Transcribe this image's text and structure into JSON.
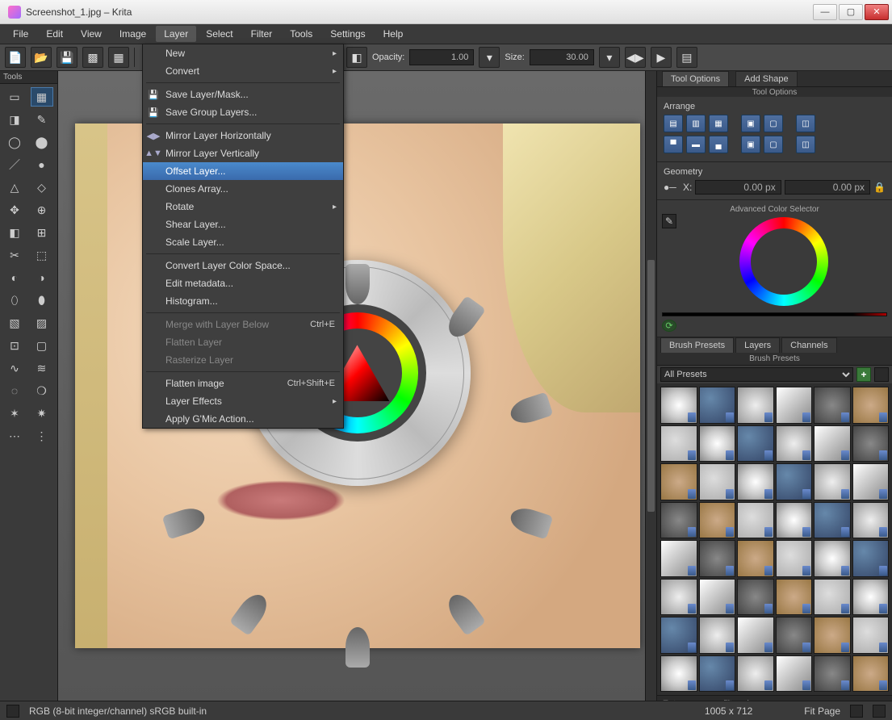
{
  "window": {
    "title": "Screenshot_1.jpg – Krita",
    "controls": {
      "min": "—",
      "max": "▢",
      "close": "✕"
    }
  },
  "menubar": [
    "File",
    "Edit",
    "View",
    "Image",
    "Layer",
    "Select",
    "Filter",
    "Tools",
    "Settings",
    "Help"
  ],
  "menubar_open_index": 4,
  "toolbar": {
    "opacity_label": "Opacity:",
    "opacity_value": "1.00",
    "size_label": "Size:",
    "size_value": "30.00"
  },
  "dropdown": {
    "items": [
      {
        "label": "New",
        "submenu": true
      },
      {
        "label": "Convert",
        "submenu": true
      },
      {
        "sep": true
      },
      {
        "label": "Save Layer/Mask...",
        "icon": "💾"
      },
      {
        "label": "Save Group Layers...",
        "icon": "💾"
      },
      {
        "sep": true
      },
      {
        "label": "Mirror Layer Horizontally",
        "icon": "◀▶"
      },
      {
        "label": "Mirror Layer Vertically",
        "icon": "▲▼"
      },
      {
        "label": "Offset Layer...",
        "hl": true
      },
      {
        "label": "Clones Array..."
      },
      {
        "label": "Rotate",
        "submenu": true
      },
      {
        "label": "Shear Layer..."
      },
      {
        "label": "Scale Layer..."
      },
      {
        "sep": true
      },
      {
        "label": "Convert Layer Color Space..."
      },
      {
        "label": "Edit metadata..."
      },
      {
        "label": "Histogram..."
      },
      {
        "sep": true
      },
      {
        "label": "Merge with Layer Below",
        "shortcut": "Ctrl+E",
        "disabled": true
      },
      {
        "label": "Flatten Layer",
        "disabled": true
      },
      {
        "label": "Rasterize Layer",
        "disabled": true
      },
      {
        "sep": true
      },
      {
        "label": "Flatten image",
        "shortcut": "Ctrl+Shift+E"
      },
      {
        "label": "Layer Effects",
        "submenu": true
      },
      {
        "label": "Apply G'Mic Action..."
      }
    ]
  },
  "toolbox": {
    "title": "Tools"
  },
  "right": {
    "tabs_top": [
      "Tool Options",
      "Add Shape"
    ],
    "tool_options_title": "Tool Options",
    "arrange_label": "Arrange",
    "geometry_label": "Geometry",
    "geo_x_label": "X:",
    "geo_x_value": "0.00 px",
    "geo_y_value": "0.00 px",
    "color_selector_title": "Advanced Color Selector",
    "presets_tabs": [
      "Brush Presets",
      "Layers",
      "Channels"
    ],
    "presets_title": "Brush Presets",
    "presets_filter_value": "All Presets",
    "presets_filter_placeholder": "Enter resource filters here"
  },
  "statusbar": {
    "colorspace": "RGB (8-bit integer/channel)  sRGB built-in",
    "dimensions": "1005 x 712",
    "zoom": "Fit Page"
  }
}
